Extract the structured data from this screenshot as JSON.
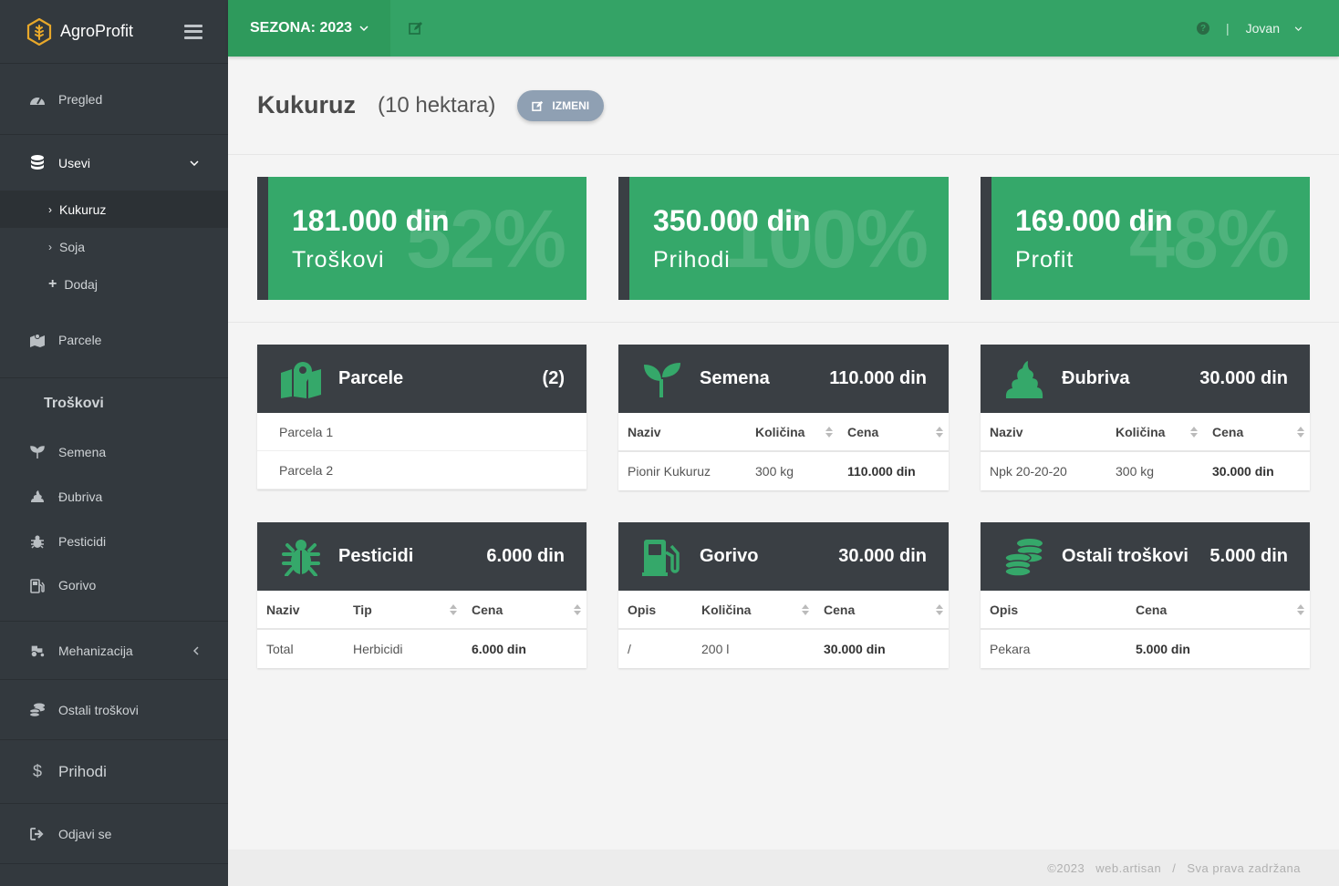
{
  "brand": {
    "name": "AgroProfit"
  },
  "sidebar": {
    "items": [
      {
        "label": "Pregled"
      },
      {
        "label": "Usevi"
      },
      {
        "label": "Parcele"
      },
      {
        "label": "Mehanizacija"
      },
      {
        "label": "Ostali troškovi"
      },
      {
        "label": "Prihodi"
      },
      {
        "label": "Odjavi se"
      }
    ],
    "subitems": [
      {
        "label": "Kukuruz"
      },
      {
        "label": "Soja"
      },
      {
        "label": "Dodaj"
      }
    ],
    "section_title": "Troškovi",
    "cost_items": [
      {
        "label": "Semena"
      },
      {
        "label": "Đubriva"
      },
      {
        "label": "Pesticidi"
      },
      {
        "label": "Gorivo"
      }
    ]
  },
  "topbar": {
    "season": "SEZONA: 2023",
    "help": "?",
    "user": "Jovan"
  },
  "header": {
    "title": "Kukuruz",
    "subtitle": "(10 hektara)",
    "edit_label": "IZMENI"
  },
  "stats": [
    {
      "amount": "181.000 din",
      "label": "Troškovi",
      "percent": "52%"
    },
    {
      "amount": "350.000 din",
      "label": "Prihodi",
      "percent": "100%"
    },
    {
      "amount": "169.000 din",
      "label": "Profit",
      "percent": "48%"
    }
  ],
  "cards": {
    "parcele": {
      "title": "Parcele",
      "value": "(2)",
      "items": [
        "Parcela 1",
        "Parcela 2"
      ]
    },
    "semena": {
      "title": "Semena",
      "value": "110.000 din",
      "columns": [
        "Naziv",
        "Količina",
        "Cena"
      ],
      "rows": [
        [
          "Pionir Kukuruz",
          "300 kg",
          "110.000 din"
        ]
      ]
    },
    "dubriva": {
      "title": "Đubriva",
      "value": "30.000 din",
      "columns": [
        "Naziv",
        "Količina",
        "Cena"
      ],
      "rows": [
        [
          "Npk 20-20-20",
          "300 kg",
          "30.000 din"
        ]
      ]
    },
    "pesticidi": {
      "title": "Pesticidi",
      "value": "6.000 din",
      "columns": [
        "Naziv",
        "Tip",
        "Cena"
      ],
      "rows": [
        [
          "Total",
          "Herbicidi",
          "6.000 din"
        ]
      ]
    },
    "gorivo": {
      "title": "Gorivo",
      "value": "30.000 din",
      "columns": [
        "Opis",
        "Količina",
        "Cena"
      ],
      "rows": [
        [
          "/",
          "200 l",
          "30.000 din"
        ]
      ]
    },
    "ostali": {
      "title": "Ostali troškovi",
      "value": "5.000 din",
      "columns": [
        "Opis",
        "Cena"
      ],
      "rows": [
        [
          "Pekara",
          "5.000 din"
        ]
      ]
    }
  },
  "footer": {
    "copyright": "©2023",
    "author": "web.artisan",
    "separator": "/",
    "rights": "Sva prava zadržana"
  },
  "colors": {
    "primary": "#34a366",
    "sidebar": "#33393e",
    "card_header": "#3a3f44",
    "edit_button": "#8fa0b3"
  }
}
